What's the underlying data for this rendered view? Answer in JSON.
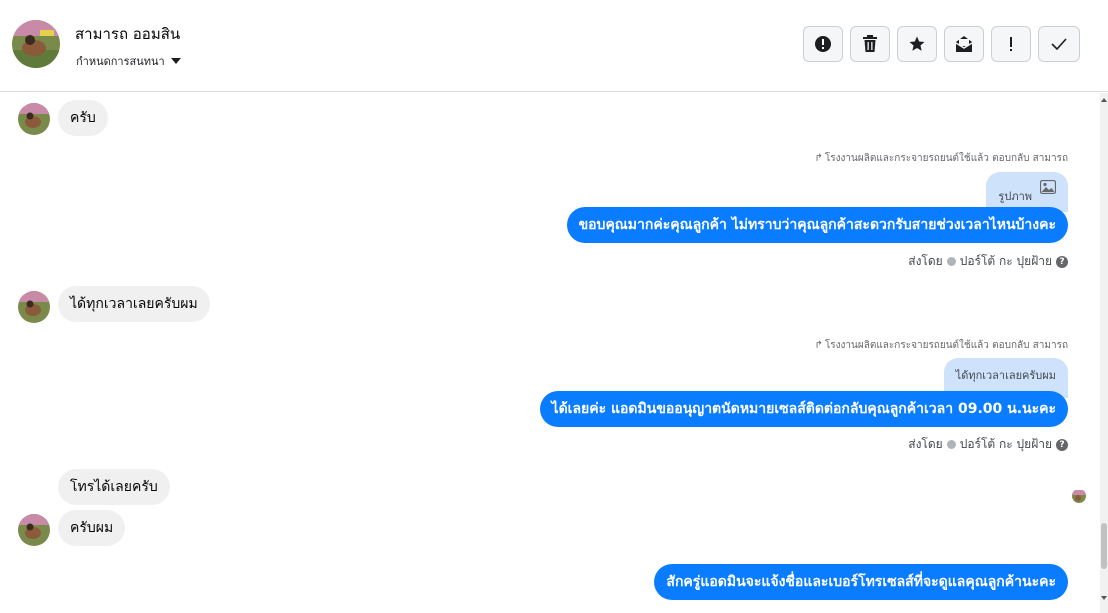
{
  "header": {
    "contact_name": "สามารถ ออมสิน",
    "conversation_menu_label": "กำหนดการสนทนา",
    "toolbar": {
      "buttons": [
        {
          "icon": "alert-circle-icon"
        },
        {
          "icon": "trash-icon"
        },
        {
          "icon": "star-icon"
        },
        {
          "icon": "envelope-open-icon"
        },
        {
          "icon": "exclamation-icon"
        },
        {
          "icon": "check-icon"
        }
      ]
    }
  },
  "messages": {
    "m1": {
      "text": "ครับ"
    },
    "r1": {
      "reply_note": "โรงงานผลิตและกระจายรถยนต์ใช้แล้ว ตอบกลับ สามารถ",
      "quoted_text": "รูปภาพ",
      "text": "ขอบคุณมากค่ะคุณลูกค้า ไม่ทราบว่าคุณลูกค้าสะดวกรับสายช่วงเวลาไหนบ้างคะ",
      "sent_by_label": "ส่งโดย",
      "sender_name": "ปอร์โต้ กะ ปุยฝ้าย"
    },
    "m2": {
      "text": "ได้ทุกเวลาเลยครับผม"
    },
    "r2": {
      "reply_note": "โรงงานผลิตและกระจายรถยนต์ใช้แล้ว ตอบกลับ สามารถ",
      "quoted_text": "ได้ทุกเวลาเลยครับผม",
      "text": "ได้เลยค่ะ แอดมินขออนุญาตนัดหมายเซลส์ติดต่อกลับคุณลูกค้าเวลา 09.00 น.นะคะ",
      "sent_by_label": "ส่งโดย",
      "sender_name": "ปอร์โต้ กะ ปุยฝ้าย"
    },
    "m3": {
      "text": "โทรได้เลยครับ"
    },
    "m4": {
      "text": "ครับผม"
    },
    "r3": {
      "text": "สักครู่แอดมินจะแจ้งชื่อและเบอร์โทรเซลส์ที่จะดูแลคุณลูกค้านะคะ"
    }
  },
  "colors": {
    "outgoing_bubble": "#0a7cff",
    "incoming_bubble": "#f0f0f0",
    "quoted_bubble": "#cfe2fb"
  }
}
